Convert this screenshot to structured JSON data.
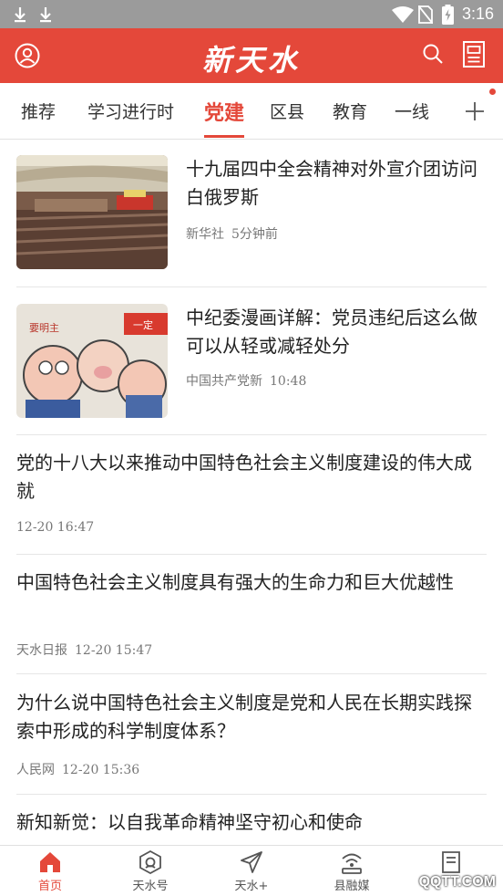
{
  "status_bar": {
    "time": "3:16"
  },
  "app_bar": {
    "logo": "新天水"
  },
  "tabs": [
    {
      "label": "推荐"
    },
    {
      "label": "学习进行时"
    },
    {
      "label": "党建"
    },
    {
      "label": "区县"
    },
    {
      "label": "教育"
    },
    {
      "label": "一线"
    }
  ],
  "news": [
    {
      "title": "十九届四中全会精神对外宣介团访问白俄罗斯",
      "source": "新华社",
      "time": "5分钟前"
    },
    {
      "title": "中纪委漫画详解：党员违纪后这么做可以从轻或减轻处分",
      "source": "中国共产党新",
      "time": "10:48",
      "thumb_text_1": "要明主",
      "thumb_text_2": "一定"
    },
    {
      "title": "党的十八大以来推动中国特色社会主义制度建设的伟大成就",
      "source": "",
      "time": "12-20  16:47"
    },
    {
      "title": "中国特色社会主义制度具有强大的生命力和巨大优越性",
      "source": "天水日报",
      "time": "12-20  15:47"
    },
    {
      "title": "为什么说中国特色社会主义制度是党和人民在长期实践探索中形成的科学制度体系？",
      "source": "人民网",
      "time": "12-20  15:36"
    },
    {
      "title": "新知新觉：以自我革命精神坚守初心和使命"
    }
  ],
  "bottom_nav": [
    {
      "label": "首页",
      "icon": "home-icon"
    },
    {
      "label": "天水号",
      "icon": "account-icon"
    },
    {
      "label": "天水+",
      "icon": "send-icon"
    },
    {
      "label": "县融媒",
      "icon": "broadcast-icon"
    },
    {
      "label": "",
      "icon": "newspaper-icon"
    }
  ],
  "watermark": "QQTT.COM",
  "colors": {
    "brand": "#e4483a",
    "status_bar": "#9b9b9b"
  }
}
